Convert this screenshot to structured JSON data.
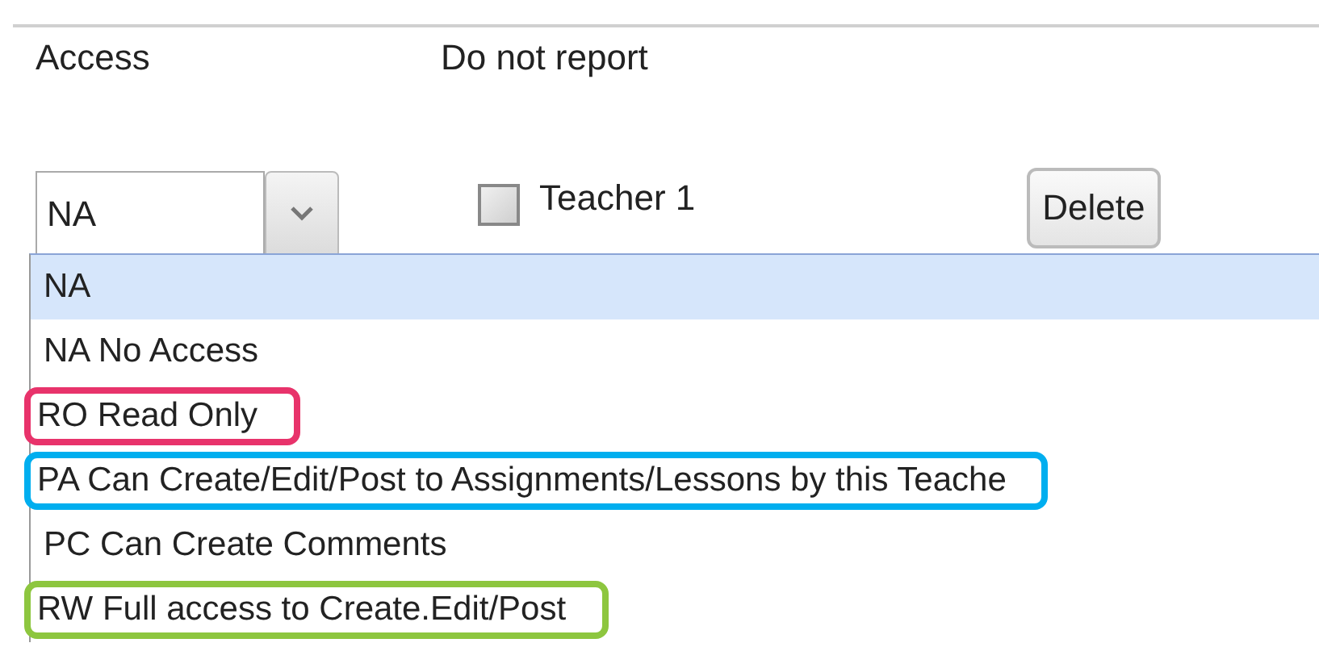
{
  "header": {
    "access_label": "Access",
    "report_label": "Do not report"
  },
  "access_select": {
    "value": "NA",
    "expanded": true
  },
  "teacher_checkbox": {
    "label": "Teacher 1",
    "checked": false
  },
  "delete_button": {
    "label": "Delete"
  },
  "options": [
    {
      "label": "NA",
      "selected": true
    },
    {
      "label": "NA No Access",
      "selected": false
    },
    {
      "label": "RO Read Only",
      "selected": false,
      "color": "#e8336b"
    },
    {
      "label": "PA Can Create/Edit/Post to Assignments/Lessons by this Teache",
      "selected": false,
      "color": "#00aeef"
    },
    {
      "label": "PC Can Create Comments",
      "selected": false
    },
    {
      "label": "RW Full access to Create.Edit/Post",
      "selected": false,
      "color": "#8dc63f"
    }
  ]
}
